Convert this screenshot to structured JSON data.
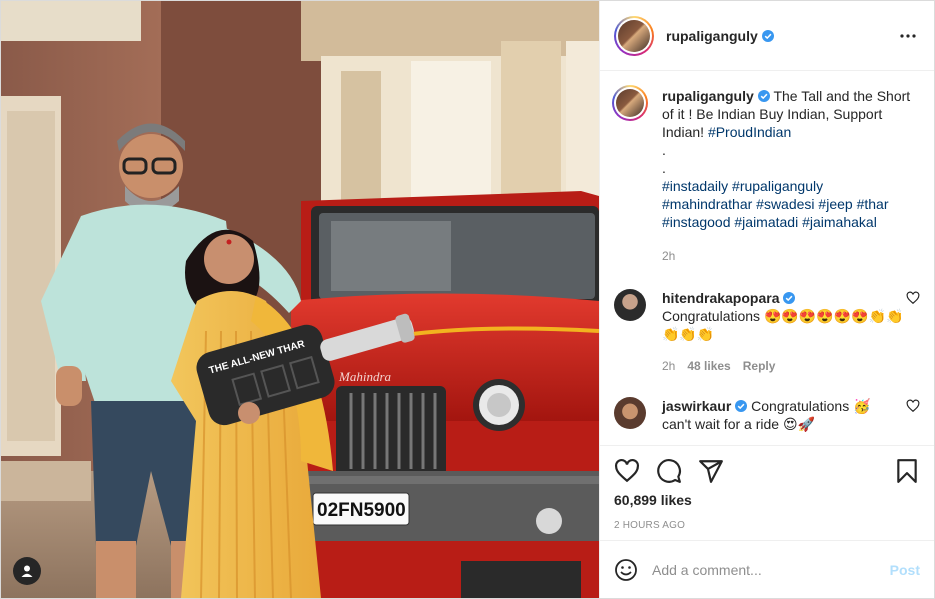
{
  "post": {
    "author": "rupaliganguly",
    "verified": true
  },
  "caption": {
    "username": "rupaliganguly",
    "text": "The Tall and the Short of it ! Be Indian Buy Indian, Support Indian!",
    "hashtag_1": "#ProudIndian",
    "dot_1": ".",
    "dot_2": ".",
    "hashtags_line_1": "#instadaily #rupaliganguly",
    "hashtags_line_2": "#mahindrathar #swadesi #jeep #thar",
    "hashtags_line_3": "#instagood #jaimatadi #jaimahakal",
    "age": "2h"
  },
  "comments": [
    {
      "username": "hitendrakapopara",
      "verified": true,
      "text": "Congratulations 😍😍😍😍😍😍👏👏👏👏👏",
      "age": "2h",
      "likes": "48 likes",
      "reply": "Reply"
    },
    {
      "username": "jaswirkaur",
      "verified": true,
      "text_line_1": "Congratulations 🥳",
      "text_line_2": "can't wait for a ride 😍🚀"
    }
  ],
  "photo": {
    "plate_text": "02FN5900",
    "brand_text": "Mahindra",
    "key_text": "THE ALL-NEW THAR"
  },
  "actions": {
    "likes": "60,899 likes",
    "timestamp": "2 HOURS AGO"
  },
  "composer": {
    "placeholder": "Add a comment...",
    "post_label": "Post"
  },
  "icons": {
    "more": "more-horizontal-icon",
    "like": "heart-icon",
    "comment": "comment-icon",
    "share": "paper-plane-icon",
    "save": "bookmark-icon",
    "emoji": "emoji-icon",
    "tag": "user-tag-icon",
    "verified": "verified-badge-icon"
  },
  "colors": {
    "verified": "#3897f0",
    "link": "#00376b",
    "muted": "#8e8e8e",
    "post_disabled": "#b2dffc",
    "car_red": "#d4231e"
  }
}
